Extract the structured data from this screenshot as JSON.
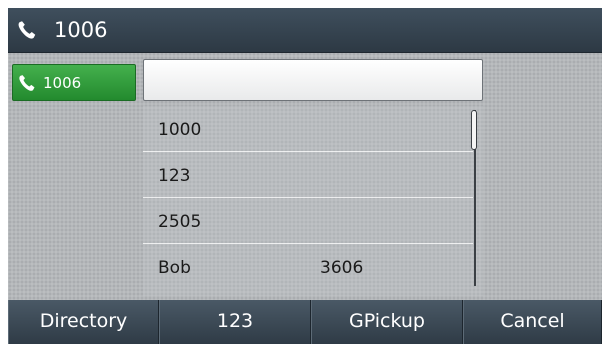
{
  "title_bar": {
    "icon": "phone-handset-icon",
    "title": "1006"
  },
  "line_key": {
    "icon": "phone-handset-icon",
    "label": "1006",
    "color": "#2f9a3a"
  },
  "input": {
    "value": "",
    "placeholder": ""
  },
  "suggestions": [
    {
      "name": "1000",
      "number": ""
    },
    {
      "name": "123",
      "number": ""
    },
    {
      "name": "2505",
      "number": ""
    },
    {
      "name": "Bob",
      "number": "3606"
    }
  ],
  "softkeys": [
    {
      "label": "Directory"
    },
    {
      "label": "123"
    },
    {
      "label": "GPickup"
    },
    {
      "label": "Cancel"
    }
  ]
}
